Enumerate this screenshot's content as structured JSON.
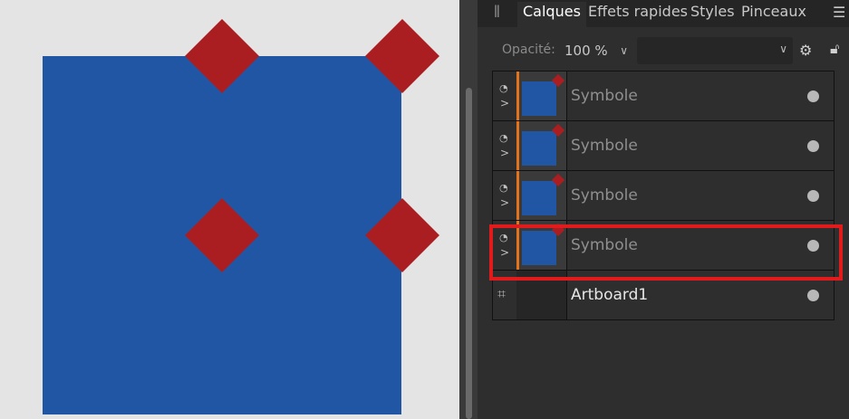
{
  "colors": {
    "canvas_bg": "#e4e4e4",
    "blue": "#2156a5",
    "red": "#aa1e22",
    "accent_orange": "#e0731c",
    "highlight_red": "#e11b1b"
  },
  "tabs": [
    {
      "label": "Calques",
      "active": true
    },
    {
      "label": "Effets rapides",
      "active": false
    },
    {
      "label": "Styles",
      "active": false
    },
    {
      "label": "Pinceaux",
      "active": false
    }
  ],
  "toolbar": {
    "opacity_label": "Opacité:",
    "opacity_value": "100 %",
    "blend_mode": ""
  },
  "layers": [
    {
      "name": "Symbole",
      "type": "symbol",
      "selected": false
    },
    {
      "name": "Symbole",
      "type": "symbol",
      "selected": false
    },
    {
      "name": "Symbole",
      "type": "symbol",
      "selected": false
    },
    {
      "name": "Symbole",
      "type": "symbol",
      "selected": true
    },
    {
      "name": "Artboard1",
      "type": "artboard",
      "selected": false
    }
  ]
}
